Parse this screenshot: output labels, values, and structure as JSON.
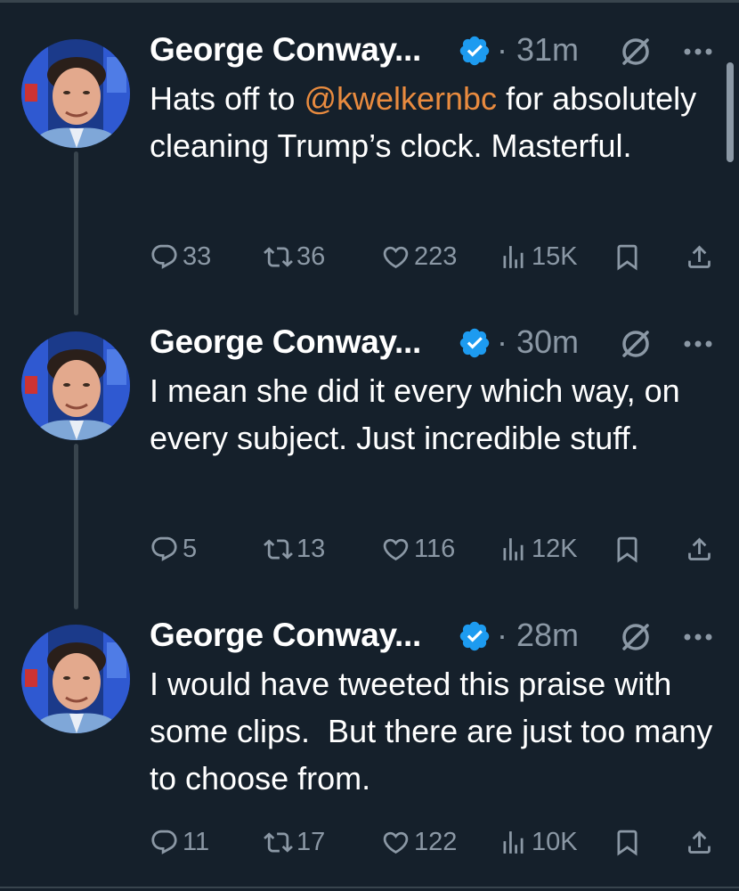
{
  "colors": {
    "background": "#15202b",
    "text": "#ffffff",
    "muted": "#8b98a5",
    "mention": "#e98b3f",
    "verified": "#1d9bf0",
    "divider": "#38444d"
  },
  "icons": {
    "verified": "verified-badge-icon",
    "grok": "grok-icon",
    "more": "more-icon",
    "reply": "reply-icon",
    "retweet": "retweet-icon",
    "like": "like-icon",
    "views": "views-icon",
    "bookmark": "bookmark-icon",
    "share": "share-icon"
  },
  "tweets": [
    {
      "author": "George Conway...",
      "time": "31m",
      "text_before": "Hats off to ",
      "mention": "@kwelkernbc",
      "text_after": " for absolutely cleaning Trump’s clock. Masterful.",
      "replies": "33",
      "retweets": "36",
      "likes": "223",
      "views": "15K"
    },
    {
      "author": "George Conway...",
      "time": "30m",
      "text_before": "I mean she did it every which way, on every subject. Just incredible stuff.",
      "mention": "",
      "text_after": "",
      "replies": "5",
      "retweets": "13",
      "likes": "116",
      "views": "12K"
    },
    {
      "author": "George Conway...",
      "time": "28m",
      "text_before": "I would have tweeted this praise with some clips.  But there are just too many to choose from.",
      "mention": "",
      "text_after": "",
      "replies": "11",
      "retweets": "17",
      "likes": "122",
      "views": "10K"
    }
  ]
}
